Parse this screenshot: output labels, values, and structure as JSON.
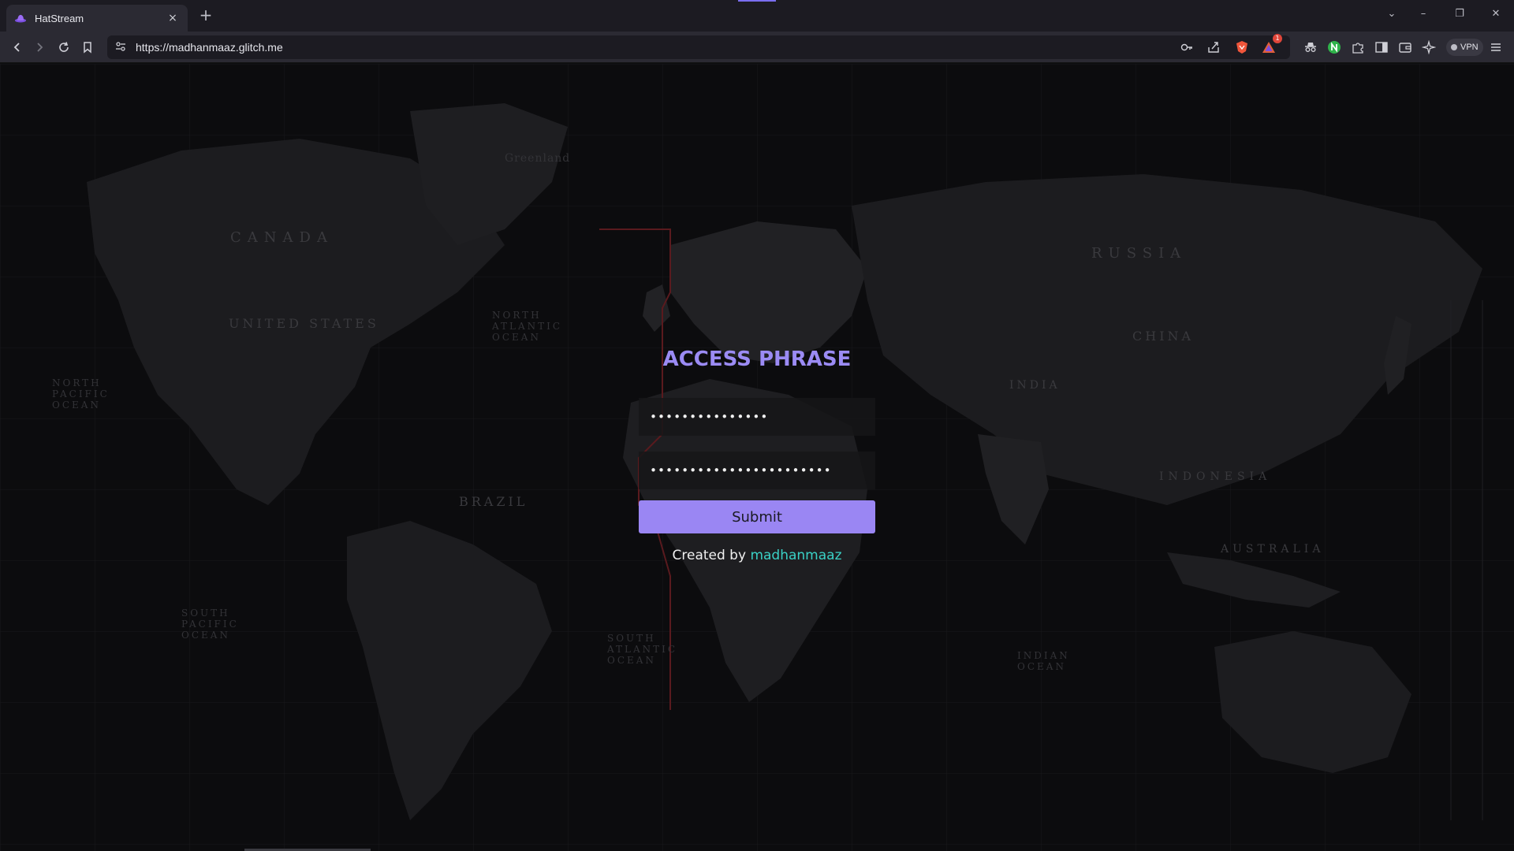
{
  "browser": {
    "tab_title": "HatStream",
    "tab_close": "×",
    "new_tab": "+",
    "url": "https://madhanmaaz.glitch.me",
    "vpn_label": "VPN",
    "notification_badge": "1",
    "window_controls": {
      "dropdown": "⌄",
      "minimize": "–",
      "restore": "❐",
      "close": "✕"
    }
  },
  "login": {
    "title": "ACCESS PHRASE",
    "field1_value": "•••••••••••••••",
    "field2_value": "•••••••••••••••••••••••",
    "submit_label": "Submit",
    "credit_prefix": "Created by ",
    "credit_name": "madhanmaaz"
  },
  "map_labels": {
    "russia": "RUSSIA",
    "canada": "CANADA",
    "united_states": "UNITED STATES",
    "china": "CHINA",
    "brazil": "BRAZIL",
    "indonesia": "INDONESIA",
    "australia": "AUSTRALIA",
    "india": "INDIA",
    "north_atlantic": "NORTH ATLANTIC OCEAN",
    "south_atlantic": "SOUTH ATLANTIC OCEAN",
    "north_pacific": "NORTH PACIFIC OCEAN",
    "south_pacific": "SOUTH PACIFIC OCEAN",
    "indian_ocean": "INDIAN OCEAN",
    "greenland": "Greenland"
  },
  "colors": {
    "accent": "#9a86f3",
    "title": "#9b8bf4",
    "credit_link": "#3ad1c6",
    "background": "#0c0c0e"
  }
}
